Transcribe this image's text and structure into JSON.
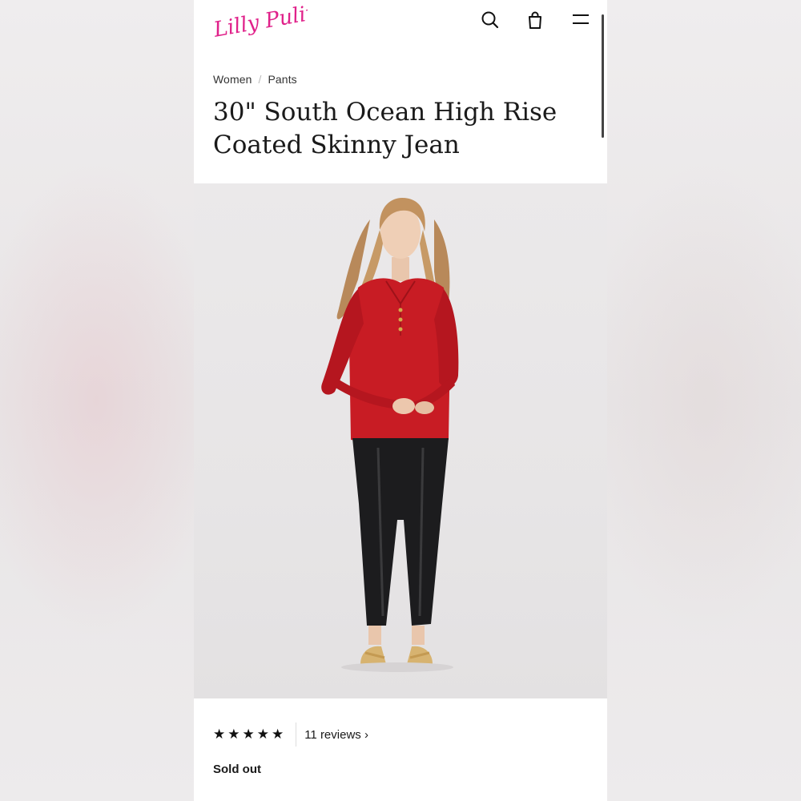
{
  "header": {
    "brand": "Lilly Pulitzer",
    "icons": [
      "search-icon",
      "bag-icon",
      "menu-icon"
    ]
  },
  "breadcrumb": {
    "items": [
      "Women",
      "Pants"
    ],
    "separator": "/"
  },
  "product": {
    "title": "30\" South Ocean High Rise Coated Skinny Jean",
    "rating_stars": "★★★★★",
    "reviews_label": "11 reviews ›",
    "status": "Sold out"
  },
  "colors": {
    "brand_pink": "#e0218a",
    "text": "#1a1a1a"
  }
}
